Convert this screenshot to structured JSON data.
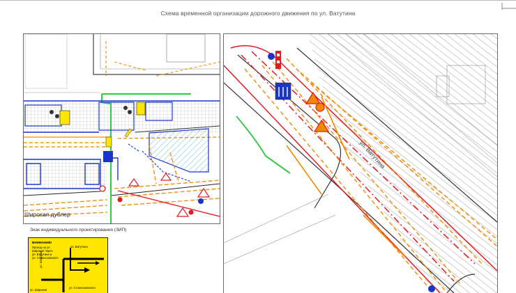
{
  "document": {
    "title": "Схема временной организации дорожного движения по ул. Ватутина"
  },
  "left_panel": {
    "street_label": "Широкая дублер"
  },
  "right_panel": {
    "street_label": "ул. Ватутина"
  },
  "custom_sign": {
    "caption": "Знак индивидуального проектирования (ЗИП)",
    "heading": "ВНИМАНИЕ!",
    "lines": [
      "Проезд на ул.",
      "Широкая через",
      "ул. Ватутина и",
      "ул. Станиславского"
    ],
    "road_label_top": "ул. Ватутина",
    "road_label_left": "ул. Широкая",
    "road_label_bottom": "ул. Станиславского",
    "road_label_bottom_left": "ул. Широкая"
  },
  "colors": {
    "construction_orange": "#f08a00",
    "closure_red": "#e11b22",
    "crossing_blue": "#1a35c9",
    "sign_yellow": "#ffe600",
    "green_boundary": "#39c84a",
    "hatch_blue": "#3aa8d8"
  }
}
